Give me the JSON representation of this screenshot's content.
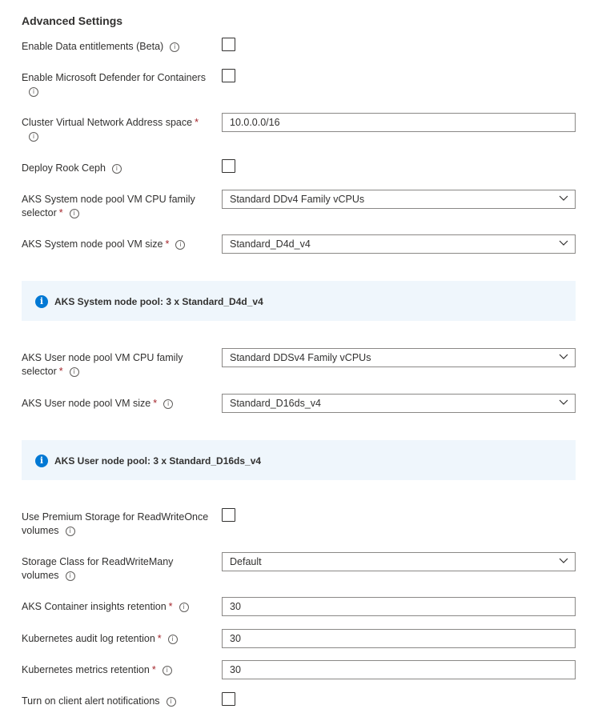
{
  "section_title": "Advanced Settings",
  "fields": {
    "data_entitlements": {
      "label": "Enable Data entitlements (Beta)",
      "checked": false
    },
    "defender": {
      "label": "Enable Microsoft Defender for Containers",
      "checked": false
    },
    "vnet": {
      "label": "Cluster Virtual Network Address space",
      "required_mark": "*",
      "value": "10.0.0.0/16"
    },
    "rook_ceph": {
      "label": "Deploy Rook Ceph",
      "checked": false
    },
    "sys_cpu_family": {
      "label_line1": "AKS System node pool VM CPU family",
      "label_line2": "selector",
      "required_mark": "*",
      "value": "Standard DDv4 Family vCPUs"
    },
    "sys_vm_size": {
      "label": "AKS System node pool VM size",
      "required_mark": "*",
      "value": "Standard_D4d_v4"
    },
    "sys_banner": "AKS System node pool: 3 x Standard_D4d_v4",
    "user_cpu_family": {
      "label_line1": "AKS User node pool VM CPU family",
      "label_line2": "selector",
      "required_mark": "*",
      "value": "Standard DDSv4 Family vCPUs"
    },
    "user_vm_size": {
      "label": "AKS User node pool VM size",
      "required_mark": "*",
      "value": "Standard_D16ds_v4"
    },
    "user_banner": "AKS User node pool: 3 x Standard_D16ds_v4",
    "premium_storage": {
      "label_line1": "Use Premium Storage for ReadWriteOnce",
      "label_line2": "volumes",
      "checked": false
    },
    "storage_class": {
      "label_line1": "Storage Class for ReadWriteMany",
      "label_line2": "volumes",
      "value": "Default"
    },
    "insights_retention": {
      "label": "AKS Container insights retention",
      "required_mark": "*",
      "value": "30"
    },
    "audit_retention": {
      "label": "Kubernetes audit log retention",
      "required_mark": "*",
      "value": "30"
    },
    "metrics_retention": {
      "label": "Kubernetes metrics retention",
      "required_mark": "*",
      "value": "30"
    },
    "alert_notifications": {
      "label": "Turn on client alert notifications",
      "checked": false
    }
  },
  "icons": {
    "info": "info-icon",
    "dropdown": "chevron-down-icon",
    "banner": "info-filled-icon"
  },
  "colors": {
    "required": "#a4262c",
    "banner_bg": "#eff6fc",
    "banner_icon": "#0078d4"
  }
}
